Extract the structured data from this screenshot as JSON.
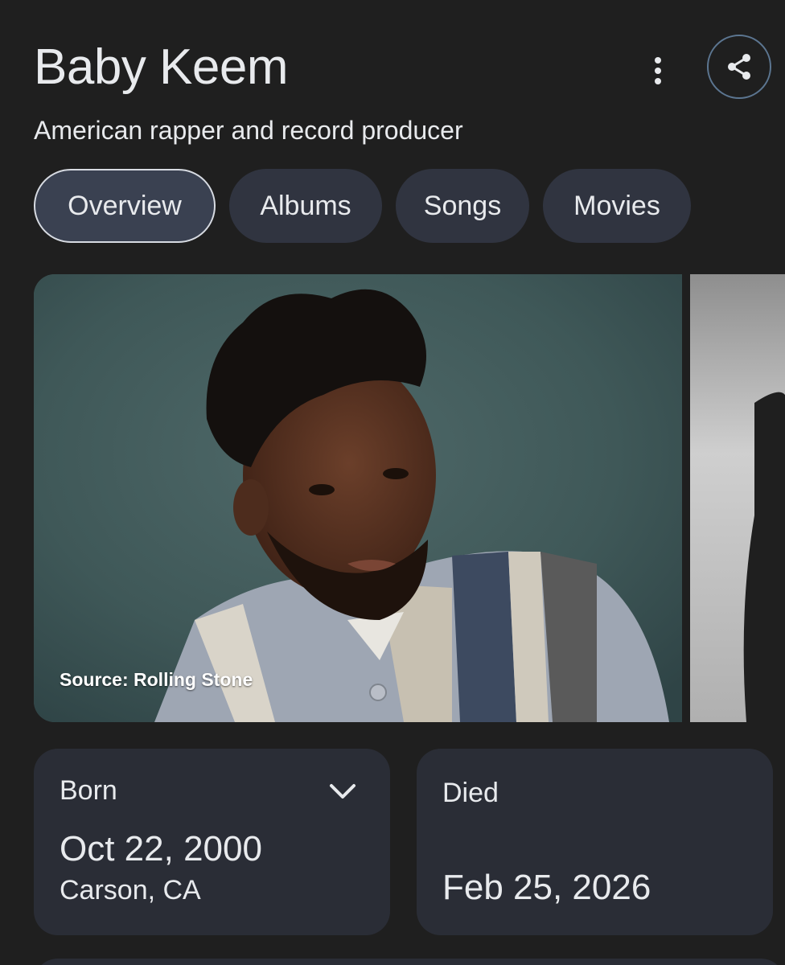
{
  "header": {
    "title": "Baby Keem",
    "subtitle": "American rapper and record producer"
  },
  "actions": {
    "more_icon": "more-vert-icon",
    "share_icon": "share-icon"
  },
  "tabs": [
    {
      "label": "Overview",
      "active": true
    },
    {
      "label": "Albums",
      "active": false
    },
    {
      "label": "Songs",
      "active": false
    },
    {
      "label": "Movies",
      "active": false
    }
  ],
  "images": {
    "source": "Source: Rolling Stone"
  },
  "facts": {
    "born": {
      "label": "Born",
      "date": "Oct 22, 2000",
      "place": "Carson, CA"
    },
    "died": {
      "label": "Died",
      "date": "Feb 25, 2026"
    }
  },
  "colors": {
    "background": "#1f1f1f",
    "chip": "#303440",
    "card": "#2a2d36",
    "share_border": "#5c7691"
  }
}
